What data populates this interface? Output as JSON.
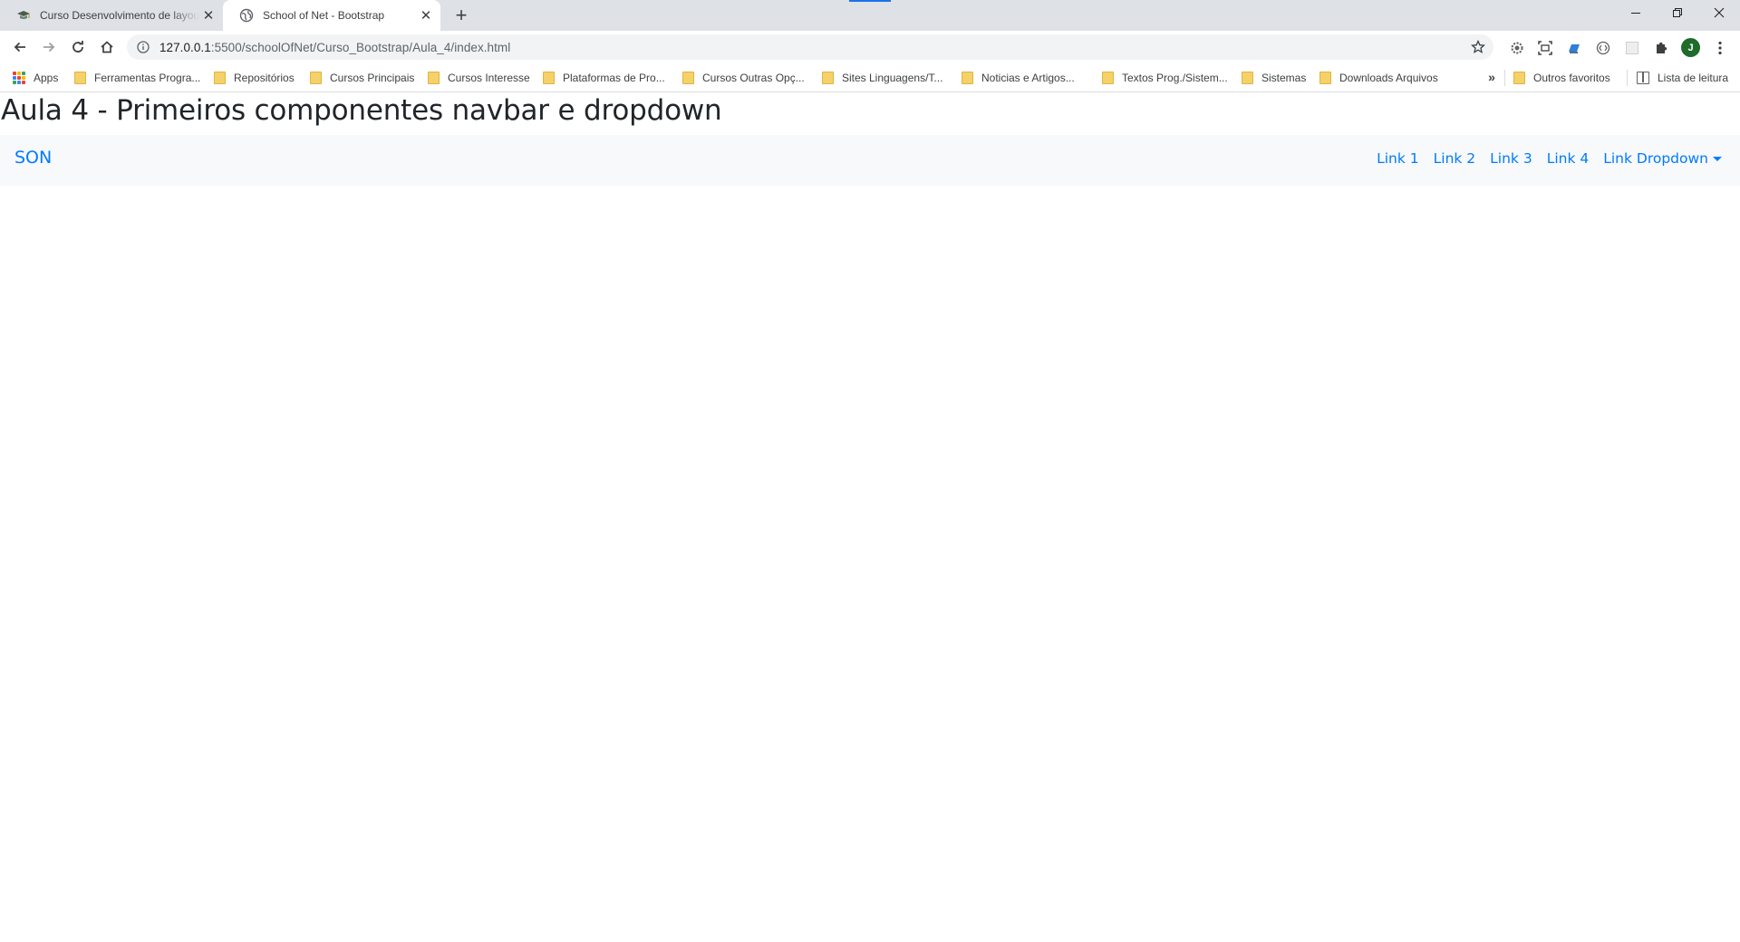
{
  "browser": {
    "tabs": [
      {
        "title": "Curso Desenvolvimento de layouts",
        "active": false
      },
      {
        "title": "School of Net - Bootstrap",
        "active": true
      }
    ],
    "address": {
      "host": "127.0.0.1",
      "path": ":5500/schoolOfNet/Curso_Bootstrap/Aula_4/index.html"
    },
    "profile_initial": "J",
    "bookmarks": [
      {
        "label": "Apps"
      },
      {
        "label": "Ferramentas Progra..."
      },
      {
        "label": "Repositórios"
      },
      {
        "label": "Cursos Principais"
      },
      {
        "label": "Cursos Interesse"
      },
      {
        "label": "Plataformas de Pro..."
      },
      {
        "label": "Cursos Outras Opç..."
      },
      {
        "label": "Sites Linguagens/T..."
      },
      {
        "label": "Noticias e Artigos..."
      },
      {
        "label": "Textos Prog./Sistem..."
      },
      {
        "label": "Sistemas"
      },
      {
        "label": "Downloads Arquivos"
      }
    ],
    "more_bookmarks": "»",
    "other_bookmarks": "Outros favoritos",
    "reading_list": "Lista de leitura"
  },
  "page": {
    "heading": "Aula 4 - Primeiros componentes navbar e dropdown",
    "navbar": {
      "brand": "SON",
      "links": [
        "Link 1",
        "Link 2",
        "Link 3",
        "Link 4"
      ],
      "dropdown_label": "Link Dropdown"
    }
  },
  "colors": {
    "link": "#007bff",
    "navbar_bg": "#f8f9fa",
    "heading": "#212529",
    "tabstrip": "#dee1e6"
  }
}
